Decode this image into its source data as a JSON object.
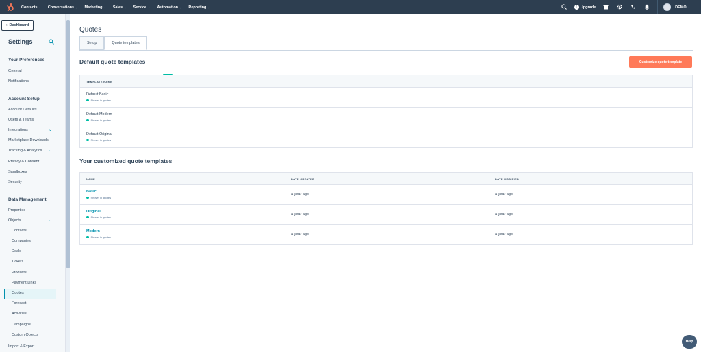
{
  "topnav": {
    "items": [
      "Contacts",
      "Conversations",
      "Marketing",
      "Sales",
      "Service",
      "Automation",
      "Reporting"
    ],
    "upgrade_label": "Upgrade",
    "account_label": "DEMO"
  },
  "sidebar": {
    "back_label": "Dashboard",
    "title": "Settings",
    "groups": [
      {
        "heading": "Your Preferences",
        "items": [
          "General",
          "Notifications"
        ]
      },
      {
        "heading": "Account Setup",
        "items": [
          "Account Defaults",
          "Users & Teams",
          "Integrations",
          "Marketplace Downloads",
          "Tracking & Analytics",
          "Privacy & Consent",
          "Sandboxes",
          "Security"
        ]
      },
      {
        "heading": "Data Management",
        "items": [
          "Properties",
          "Objects",
          "Contacts",
          "Companies",
          "Deals",
          "Tickets",
          "Products",
          "Payment Links",
          "Quotes",
          "Forecast",
          "Activities",
          "Campaigns",
          "Custom Objects",
          "Import & Export"
        ]
      }
    ],
    "active_item": "Quotes"
  },
  "main": {
    "page_title": "Quotes",
    "tabs": [
      "Setup",
      "Quote templates"
    ],
    "active_tab": "Quote templates",
    "default_section": {
      "title": "Default quote templates",
      "badge": "NEW",
      "button_label": "Customize quote template",
      "column": "TEMPLATE NAME",
      "rows": [
        {
          "name": "Default Basic",
          "status": "Shown in quotes"
        },
        {
          "name": "Default Modern",
          "status": "Shown in quotes"
        },
        {
          "name": "Default Original",
          "status": "Shown in quotes"
        }
      ]
    },
    "custom_section": {
      "title": "Your customized quote templates",
      "columns": [
        "NAME",
        "DATE CREATED",
        "DATE MODIFIED"
      ],
      "rows": [
        {
          "name": "Basic",
          "status": "Shown in quotes",
          "created": "a year ago",
          "modified": "a year ago"
        },
        {
          "name": "Original",
          "status": "Shown in quotes",
          "created": "a year ago",
          "modified": "a year ago"
        },
        {
          "name": "Modern",
          "status": "Shown in quotes",
          "created": "a year ago",
          "modified": "a year ago"
        }
      ]
    }
  },
  "help_label": "Help",
  "colors": {
    "nav_bg": "#2d3e50",
    "accent_orange": "#ff7a59",
    "link_teal": "#0091ae",
    "status_green": "#00bda5"
  },
  "icons": [
    "hubspot-logo-icon",
    "search-icon",
    "marketplace-icon",
    "settings-icon",
    "calling-icon",
    "notifications-icon",
    "info-icon",
    "chevron-down-icon",
    "chevron-left-icon"
  ]
}
